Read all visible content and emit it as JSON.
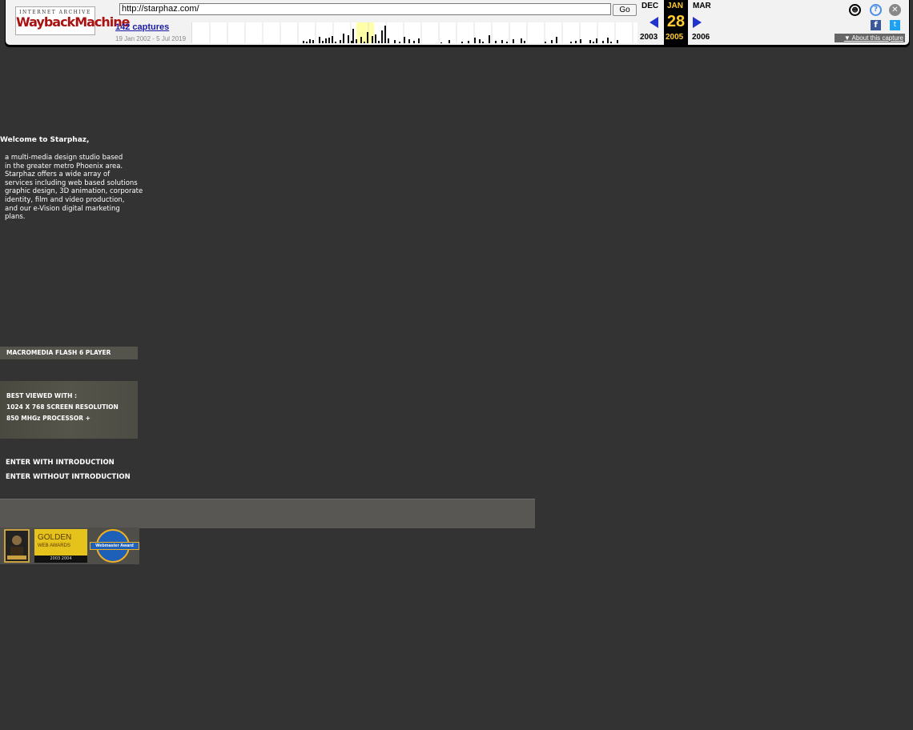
{
  "wayback": {
    "logo_top": "INTERNET ARCHIVE",
    "logo_main": "WaybackMachine",
    "url": "http://starphaz.com/",
    "go_label": "Go",
    "captures_label": "142 captures",
    "date_range": "19 Jan 2002 - 5 Jul 2019",
    "prev_month": "DEC",
    "current_month": "JAN",
    "next_month": "MAR",
    "current_day": "28",
    "prev_year": "2003",
    "current_year": "2005",
    "next_year": "2006",
    "about_label": "About this capture",
    "icons": [
      "user-icon",
      "help-icon",
      "close-icon",
      "facebook-icon",
      "twitter-icon"
    ]
  },
  "page": {
    "welcome": "Welcome to Starphaz,",
    "intro": "a multi-media design studio based\nin the greater metro Phoenix area.\nStarphaz offers a wide array of\nservices including web based solutions\ngraphic design, 3D animation, corporate\nidentity, film and video production,\nand our e-Vision digital marketing\nplans.",
    "flash_label": "MACROMEDIA FLASH 6 PLAYER",
    "best_viewed": {
      "heading": "BEST VIEWED WITH :",
      "line1": "1024 X 768 SCREEN RESOLUTION",
      "line2": "850 MHGz  PROCESSOR +"
    },
    "enter_intro": "ENTER WITH INTRODUCTION",
    "enter_no_intro": "ENTER WITHOUT INTRODUCTION",
    "awards": {
      "golden_title": "GOLDEN",
      "golden_sub": "WEB AWARDS",
      "golden_years": "2003   2004",
      "webmaster": "Webmaster Award",
      "webmaster_ring": "WINNING WEBSITE"
    }
  },
  "colors": {
    "background": "#333333",
    "accent_yellow": "#ffcc33",
    "link_blue": "#1a1aa6"
  }
}
